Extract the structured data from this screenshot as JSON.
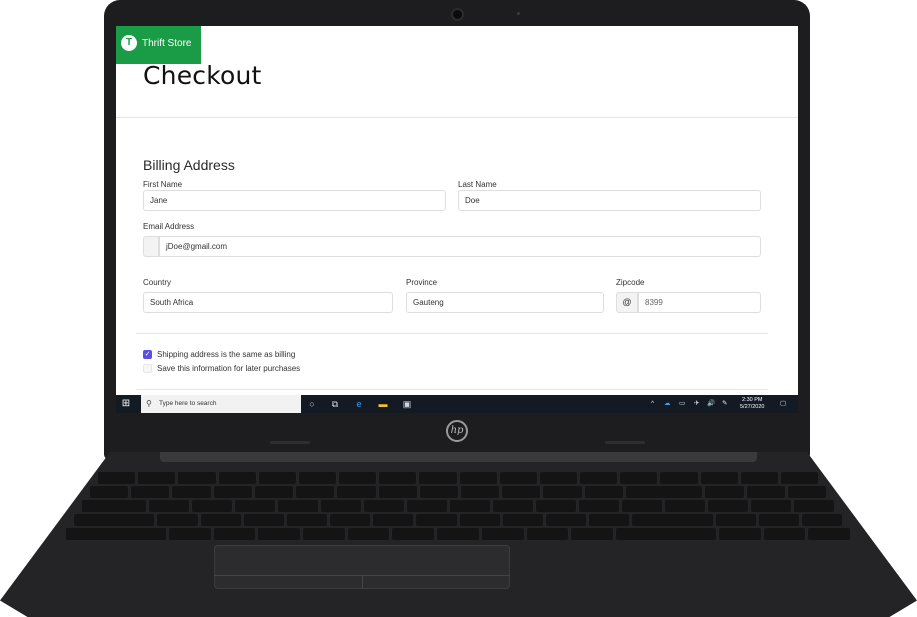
{
  "brand": {
    "initial": "T",
    "name": "Thrift Store"
  },
  "page_title": "Checkout",
  "billing": {
    "section_title": "Billing Address",
    "first_name_label": "First Name",
    "first_name_value": "Jane",
    "last_name_label": "Last Name",
    "last_name_value": "Doe",
    "email_label": "Email Address",
    "email_value": "jDoe@gmail.com",
    "country_label": "Country",
    "country_value": "South Africa",
    "province_label": "Province",
    "province_value": "Gauteng",
    "zipcode_label": "Zipcode",
    "zipcode_prefix": "@",
    "zipcode_value": "8399"
  },
  "options": {
    "same_address_label": "Shipping address is the same as billing",
    "same_address_checked": true,
    "save_info_label": "Save this information for later purchases",
    "save_info_checked": false
  },
  "taskbar": {
    "search_placeholder": "Type here to search",
    "time": "2:30 PM",
    "date": "5/27/2020",
    "pinned_icons": [
      "task-view-icon",
      "edge-icon",
      "file-explorer-icon",
      "store-icon"
    ]
  },
  "laptop": {
    "logo": "hp"
  },
  "colors": {
    "brand_green": "#1a9b45",
    "checkbox_accent": "#5b4ee6",
    "taskbar": "#141a24"
  }
}
